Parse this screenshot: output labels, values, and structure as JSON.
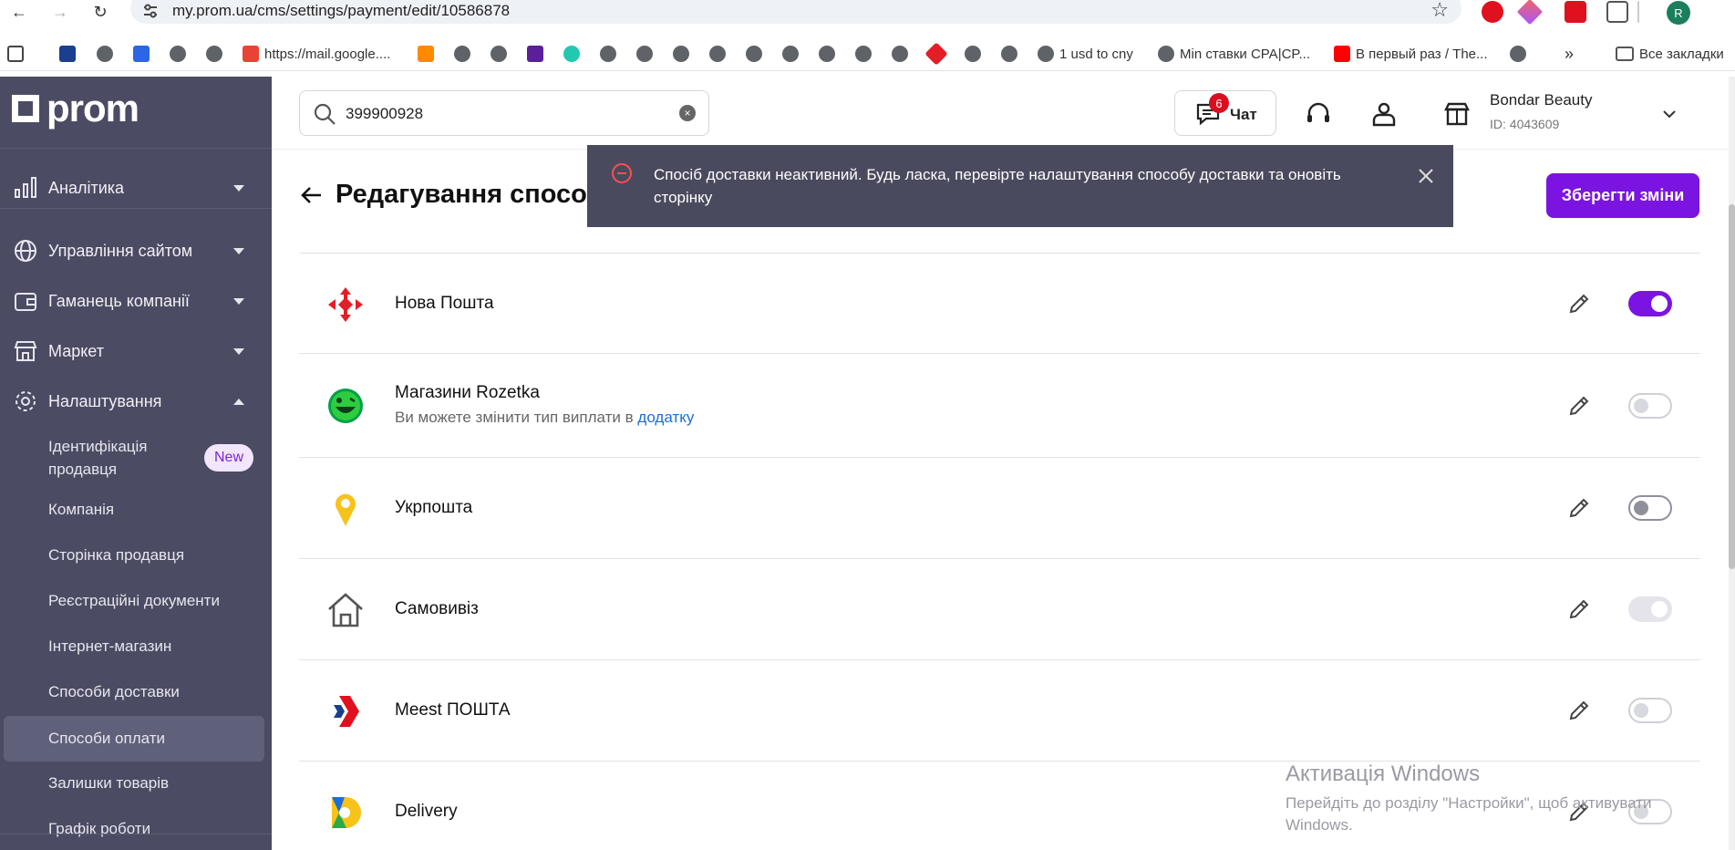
{
  "browser": {
    "url": "my.prom.ua/cms/settings/payment/edit/10586878",
    "profile_initial": "R",
    "bookmarks": [
      {
        "label": "https://mail.google...."
      },
      {
        "label": "1 usd to cny"
      },
      {
        "label": "Min ставки CPA|CP..."
      },
      {
        "label": "В первый раз / The..."
      },
      {
        "label": "Все закладки"
      }
    ]
  },
  "sidebar": {
    "logo_text": "prom",
    "items": [
      {
        "label": "Аналітика"
      },
      {
        "label": "Управління сайтом"
      },
      {
        "label": "Гаманець компанії"
      },
      {
        "label": "Маркет"
      },
      {
        "label": "Налаштування"
      }
    ],
    "subitems": [
      {
        "label": "Ідентифікація продавця",
        "badge": "New"
      },
      {
        "label": "Компанія"
      },
      {
        "label": "Сторінка продавця"
      },
      {
        "label": "Реєстраційні документи"
      },
      {
        "label": "Інтернет-магазин"
      },
      {
        "label": "Способи доставки"
      },
      {
        "label": "Способи оплати"
      },
      {
        "label": "Залишки товарів"
      },
      {
        "label": "Графік роботи"
      }
    ]
  },
  "header": {
    "search_value": "399900928",
    "chat_label": "Чат",
    "chat_count": "6",
    "account_name": "Bondar Beauty",
    "account_id": "ID: 4043609"
  },
  "page": {
    "title": "Редагування способу оплати",
    "save_label": "Зберегти зміни"
  },
  "toast": {
    "message": "Спосіб доставки неактивний. Будь ласка, перевірте налаштування способу доставки та оновіть сторінку"
  },
  "delivery_methods": [
    {
      "name": "Нова Пошта",
      "enabled": true
    },
    {
      "name": "Магазини Rozetka",
      "sub_text": "Ви можете змінити тип виплати в",
      "sub_link": "додатку",
      "enabled": false
    },
    {
      "name": "Укрпошта",
      "enabled": false
    },
    {
      "name": "Самовивіз",
      "enabled": true
    },
    {
      "name": "Meest ПОШТА",
      "enabled": false
    },
    {
      "name": "Delivery",
      "enabled": false
    }
  ],
  "watermark": {
    "title": "Активація Windows",
    "text": "Перейдіть до розділу \"Настройки\", щоб активувати Windows."
  },
  "colors": {
    "accent": "#7b14e0",
    "sidebar_bg": "#4b4c63",
    "toast_bg": "#494a5e",
    "error": "#ff4d4f",
    "link": "#1b6fd8"
  }
}
